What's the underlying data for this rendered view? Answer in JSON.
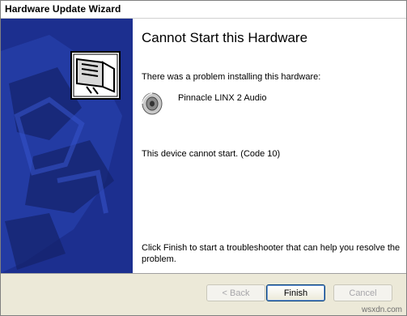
{
  "window": {
    "title": "Hardware Update Wizard"
  },
  "main": {
    "heading": "Cannot Start this Hardware",
    "problem_text": "There was a problem installing this hardware:",
    "device_name": "Pinnacle LINX 2 Audio",
    "status_text": "This device cannot start. (Code 10)",
    "finish_instructions": "Click Finish to start a troubleshooter that can help you resolve the problem."
  },
  "buttons": {
    "back": "< Back",
    "finish": "Finish",
    "cancel": "Cancel"
  },
  "watermark": "wsxdn.com",
  "colors": {
    "banner": "#1c2f8f",
    "footer": "#ece9d8"
  }
}
